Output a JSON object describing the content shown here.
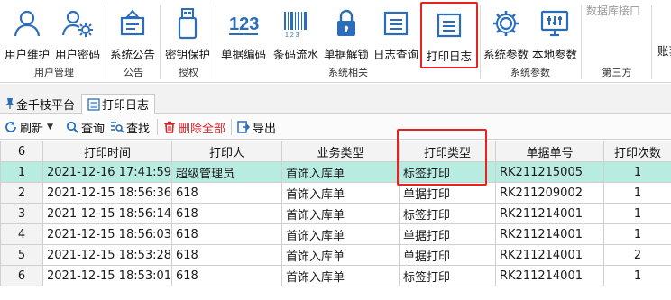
{
  "ribbon": {
    "buttons": [
      {
        "label": "用户维护",
        "icon": "user-icon"
      },
      {
        "label": "用户密码",
        "icon": "user-settings-icon"
      },
      {
        "label": "系统公告",
        "icon": "announcement-icon"
      },
      {
        "label": "密钥保护",
        "icon": "usb-key-icon"
      },
      {
        "label": "单据编码",
        "icon": "numbers-icon"
      },
      {
        "label": "条码流水",
        "icon": "barcode-icon"
      },
      {
        "label": "单据解锁",
        "icon": "lock-icon"
      },
      {
        "label": "日志查询",
        "icon": "log-icon"
      },
      {
        "label": "打印日志",
        "icon": "print-log-icon"
      },
      {
        "label": "系统参数",
        "icon": "gear-icon"
      },
      {
        "label": "本地参数",
        "icon": "monitor-settings-icon"
      }
    ],
    "groups": [
      "用户管理",
      "公告",
      "授权",
      "系统相关",
      "系统参数",
      "第三方"
    ],
    "db_interface": "数据库接口",
    "account": "账套"
  },
  "tabs": {
    "platform": "金千枝平台",
    "current": "打印日志"
  },
  "toolbar": {
    "refresh": "刷新",
    "query": "查询",
    "find": "查找",
    "delete_all": "删除全部",
    "export": "导出"
  },
  "grid": {
    "row_count": "6",
    "columns": [
      "打印时间",
      "打印人",
      "业务类型",
      "打印类型",
      "单据单号",
      "打印次数"
    ],
    "rows": [
      {
        "idx": "1",
        "time": "2021-12-16 17:41:59",
        "person": "超级管理员",
        "biz": "首饰入库单",
        "ptype": "标签打印",
        "doc": "RK211215005",
        "count": "1"
      },
      {
        "idx": "2",
        "time": "2021-12-15 18:56:36",
        "person": "618",
        "biz": "首饰入库单",
        "ptype": "单据打印",
        "doc": "RK211209002",
        "count": "1"
      },
      {
        "idx": "3",
        "time": "2021-12-15 18:56:14",
        "person": "618",
        "biz": "首饰入库单",
        "ptype": "标签打印",
        "doc": "RK211214001",
        "count": "1"
      },
      {
        "idx": "4",
        "time": "2021-12-15 18:56:03",
        "person": "618",
        "biz": "首饰入库单",
        "ptype": "单据打印",
        "doc": "RK211214001",
        "count": "1"
      },
      {
        "idx": "5",
        "time": "2021-12-15 18:53:28",
        "person": "618",
        "biz": "首饰入库单",
        "ptype": "单据打印",
        "doc": "RK211214001",
        "count": "2"
      },
      {
        "idx": "6",
        "time": "2021-12-15 18:53:01",
        "person": "618",
        "biz": "首饰入库单",
        "ptype": "标签打印",
        "doc": "RK211214001",
        "count": "1"
      }
    ]
  },
  "colors": {
    "accent": "#2a6ebb",
    "highlight": "#e8231f",
    "selected_row": "#b9ece1",
    "delete": "#d2232a"
  }
}
